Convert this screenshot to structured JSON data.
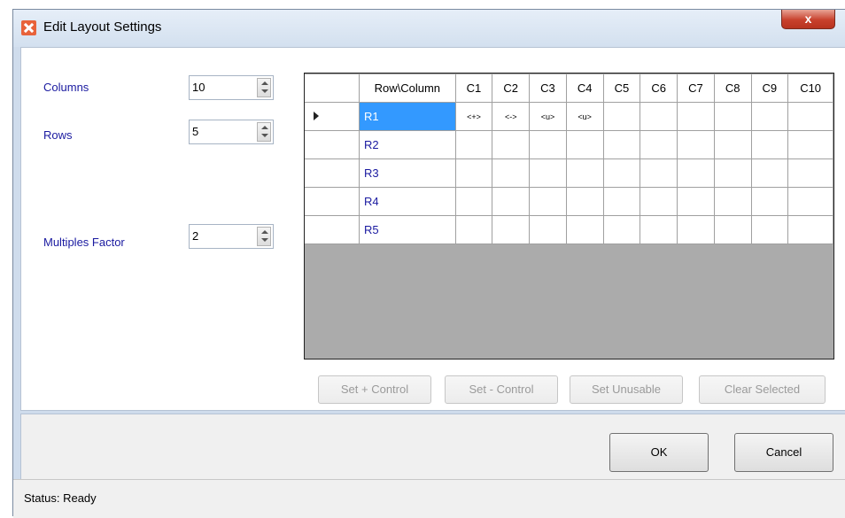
{
  "window": {
    "title": "Edit Layout Settings",
    "close_label": "x"
  },
  "form": {
    "columns_label": "Columns",
    "columns_value": "10",
    "rows_label": "Rows",
    "rows_value": "5",
    "multiples_label": "Multiples Factor",
    "multiples_value": "2"
  },
  "grid": {
    "corner_header": "Row\\Column",
    "columns": [
      "C1",
      "C2",
      "C3",
      "C4",
      "C5",
      "C6",
      "C7",
      "C8",
      "C9",
      "C10"
    ],
    "rows": [
      {
        "label": "R1",
        "selected": true,
        "cells": [
          "<+>",
          "<->",
          "<u>",
          "<u>",
          "",
          "",
          "",
          "",
          "",
          ""
        ]
      },
      {
        "label": "R2",
        "selected": false,
        "cells": [
          "",
          "",
          "",
          "",
          "",
          "",
          "",
          "",
          "",
          ""
        ]
      },
      {
        "label": "R3",
        "selected": false,
        "cells": [
          "",
          "",
          "",
          "",
          "",
          "",
          "",
          "",
          "",
          ""
        ]
      },
      {
        "label": "R4",
        "selected": false,
        "cells": [
          "",
          "",
          "",
          "",
          "",
          "",
          "",
          "",
          "",
          ""
        ]
      },
      {
        "label": "R5",
        "selected": false,
        "cells": [
          "",
          "",
          "",
          "",
          "",
          "",
          "",
          "",
          "",
          ""
        ]
      }
    ]
  },
  "actions": {
    "set_plus": "Set + Control",
    "set_minus": "Set - Control",
    "set_unusable": "Set Unusable",
    "clear_selected": "Clear Selected"
  },
  "dialog": {
    "ok": "OK",
    "cancel": "Cancel"
  },
  "status": {
    "text": "Status: Ready"
  }
}
